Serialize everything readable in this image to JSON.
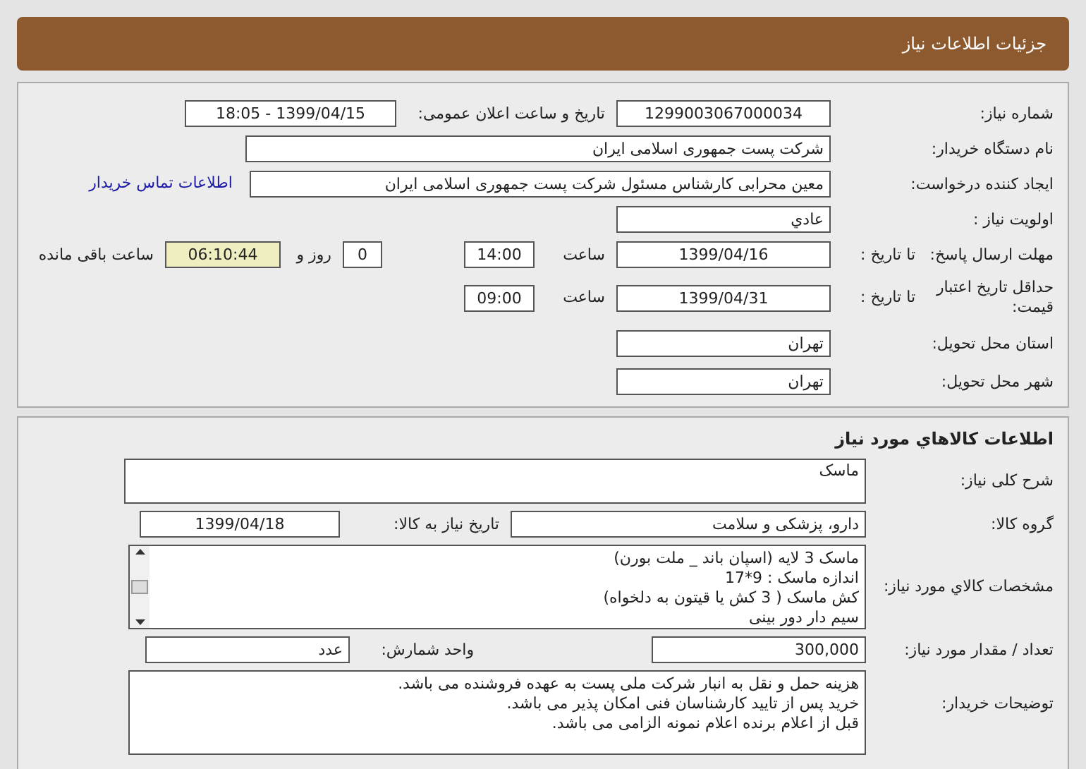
{
  "header": {
    "title": "جزئیات اطلاعات نیاز"
  },
  "need_info": {
    "need_number": {
      "label": "شماره نیاز:",
      "value": "1299003067000034"
    },
    "announce": {
      "label": "تاریخ و ساعت اعلان عمومی:",
      "value": "1399/04/15 - 18:05"
    },
    "buyer": {
      "label": "نام دستگاه خریدار:",
      "value": "شرکت پست جمهوری اسلامی ایران"
    },
    "creator": {
      "label": "ایجاد کننده درخواست:",
      "value": "معین محرابی  کارشناس مسئول  شرکت پست جمهوری اسلامی ایران",
      "link": "اطلاعات تماس خریدار"
    },
    "priority": {
      "label": "اولویت نیاز :",
      "value": "عادي"
    },
    "deadline": {
      "label": "مهلت ارسال پاسخ:",
      "to_date_label": "تا تاریخ :",
      "date": "1399/04/16",
      "time_label": "ساعت",
      "time": "14:00",
      "days": "0",
      "days_label": "روز و",
      "remaining": "06:10:44",
      "remaining_label": "ساعت باقی مانده"
    },
    "validity": {
      "label": "حداقل تاریخ اعتبار قیمت:",
      "to_date_label": "تا تاریخ :",
      "date": "1399/04/31",
      "time_label": "ساعت",
      "time": "09:00"
    },
    "province": {
      "label": "استان محل تحویل:",
      "value": "تهران"
    },
    "city": {
      "label": "شهر محل تحویل:",
      "value": "تهران"
    }
  },
  "goods": {
    "title": "اطلاعات کالاهاي مورد نياز",
    "description": {
      "label": "شرح کلی نیاز:",
      "value": "ماسک"
    },
    "group": {
      "label": "گروه کالا:",
      "value": "دارو، پزشکی و سلامت",
      "date_label": "تاریخ نیاز به کالا:",
      "date": "1399/04/18"
    },
    "specs": {
      "label": "مشخصات کالاي مورد نياز:",
      "lines": [
        "ماسک 3 لایه (اسپان باند _ ملت بورن)",
        "اندازه ماسک : 9*17",
        "کش ماسک ( 3 کش یا قیتون به دلخواه)",
        "سیم دار دور بینی"
      ]
    },
    "quantity": {
      "label": "تعداد / مقدار مورد نیاز:",
      "value": "300,000",
      "unit_label": "واحد شمارش:",
      "unit": "عدد"
    },
    "notes": {
      "label": "توضیحات خریدار:",
      "lines": [
        "هزینه حمل و نقل به انبار شرکت ملی پست به عهده فروشنده می باشد.",
        "خرید پس از تایید کارشناسان فنی امکان پذیر می باشد.",
        "قبل از اعلام برنده اعلام نمونه الزامی می باشد."
      ]
    }
  }
}
